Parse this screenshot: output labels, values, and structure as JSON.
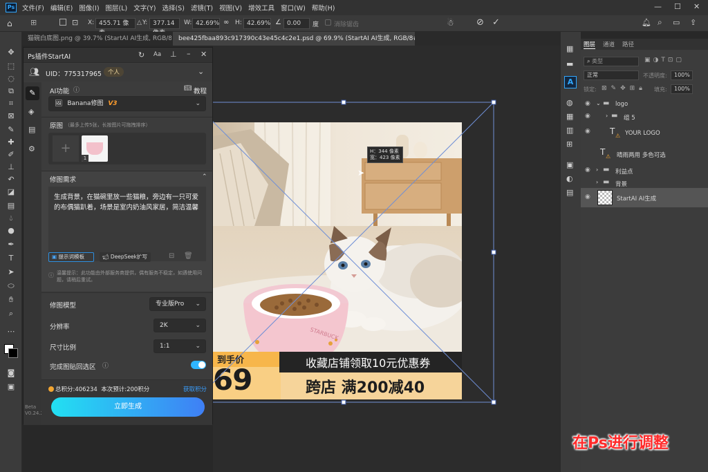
{
  "menubar": {
    "app_logo": "Ps",
    "items": [
      "文件(F)",
      "编辑(E)",
      "图像(I)",
      "图层(L)",
      "文字(Y)",
      "选择(S)",
      "滤镜(T)",
      "视图(V)",
      "增效工具",
      "窗口(W)",
      "帮助(H)"
    ],
    "window_controls": [
      "—",
      "☐",
      "✕"
    ]
  },
  "optionsbar": {
    "x_label": "X:",
    "x_value": "455.71 像素",
    "y_label": "Y:",
    "y_value": "377.14 像素",
    "w_label": "W:",
    "w_value": "42.69%",
    "h_label": "H:",
    "h_value": "42.69%",
    "angle_value": "0.00",
    "angle_unit": "度",
    "interp_label": "消除锯齿"
  },
  "tabs": [
    {
      "label": "猫碗白底图.png @ 39.7% (StartAI AI生成, RGB/8) *",
      "close": "×"
    },
    {
      "label": "bee425fbaa893c917390c43e45c4c2e1.psd @ 69.9% (StartAI AI生成, RGB/8#) *",
      "close": "×"
    }
  ],
  "plugin": {
    "title": "Ps插件StartAI",
    "header_icons": [
      "refresh-icon",
      "font-size-icon",
      "pin-icon",
      "minimize-icon",
      "close-icon"
    ],
    "uid_label": "UID：775317965",
    "account_type": "个人",
    "ai_function_label": "AI功能",
    "tutorial_label": "教程",
    "model_selected": "Banana修图",
    "model_version": "V3",
    "source_label": "原图",
    "source_hint": "（最多上传5张，长按图片可拖拽排序）",
    "thumbnail_index": "1",
    "requirement_label": "修图需求",
    "requirement_text": "生成背景，在猫碗里放一些猫粮，旁边有一只可爱的布偶猫趴着，场景是室内奶油风家居，简洁温馨",
    "prompt_template_button": "提示词模板",
    "deepseek_button": "DeepSeek扩写",
    "notice": "温馨提示：此功能由外部服务商提供，偶有服务不稳定，如遇使用问题，请稍后重试。",
    "model_label": "修图模型",
    "model_value": "专业版Pro",
    "resolution_label": "分辨率",
    "resolution_value": "2K",
    "ratio_label": "尺寸比例",
    "ratio_value": "1:1",
    "paste_back_label": "完成图贴回选区",
    "paste_back_on": true,
    "points_text": "总积分:406234  本次预计:200积分",
    "get_points_link": "获取积分",
    "generate_button": "立即生成",
    "version_line1": "Beta",
    "version_line2": "V0.24.2"
  },
  "canvas": {
    "tooltip_w": "H：344 像素",
    "tooltip_h": "宽：423 像素",
    "banner_left_top": "到手价",
    "banner_price": "69",
    "banner_coupon": "收藏店铺领取10元优惠券",
    "banner_deal": "跨店 满200减40",
    "bowl_text": "STARBUCK"
  },
  "layers_panel": {
    "tabs": [
      "图层",
      "通道",
      "路径"
    ],
    "search_placeholder": "类型",
    "blend_mode": "正常",
    "opacity_label": "不透明度:",
    "opacity_value": "100%",
    "lock_label": "锁定:",
    "fill_label": "填充:",
    "fill_value": "100%",
    "layers": [
      {
        "name": "logo",
        "type": "group",
        "visible": true
      },
      {
        "name": "组 5",
        "type": "group",
        "visible": true
      },
      {
        "name": "YOUR LOGO",
        "type": "text",
        "visible": true
      },
      {
        "name": "晴雨两用  多色可选",
        "type": "text",
        "visible": false
      },
      {
        "name": "利益点",
        "type": "group",
        "visible": true
      },
      {
        "name": "背景",
        "type": "group",
        "visible": false
      },
      {
        "name": "StartAI AI生成",
        "type": "pixel",
        "visible": true
      }
    ]
  },
  "overlay_caption": "在Ps进行调整",
  "colors": {
    "accent_blue": "#31a8ff",
    "generate_gradient_start": "#22e0f2",
    "generate_gradient_end": "#3f7ff5",
    "caption_red": "#ff2a2a",
    "toggle_on": "#2fb5ff"
  }
}
